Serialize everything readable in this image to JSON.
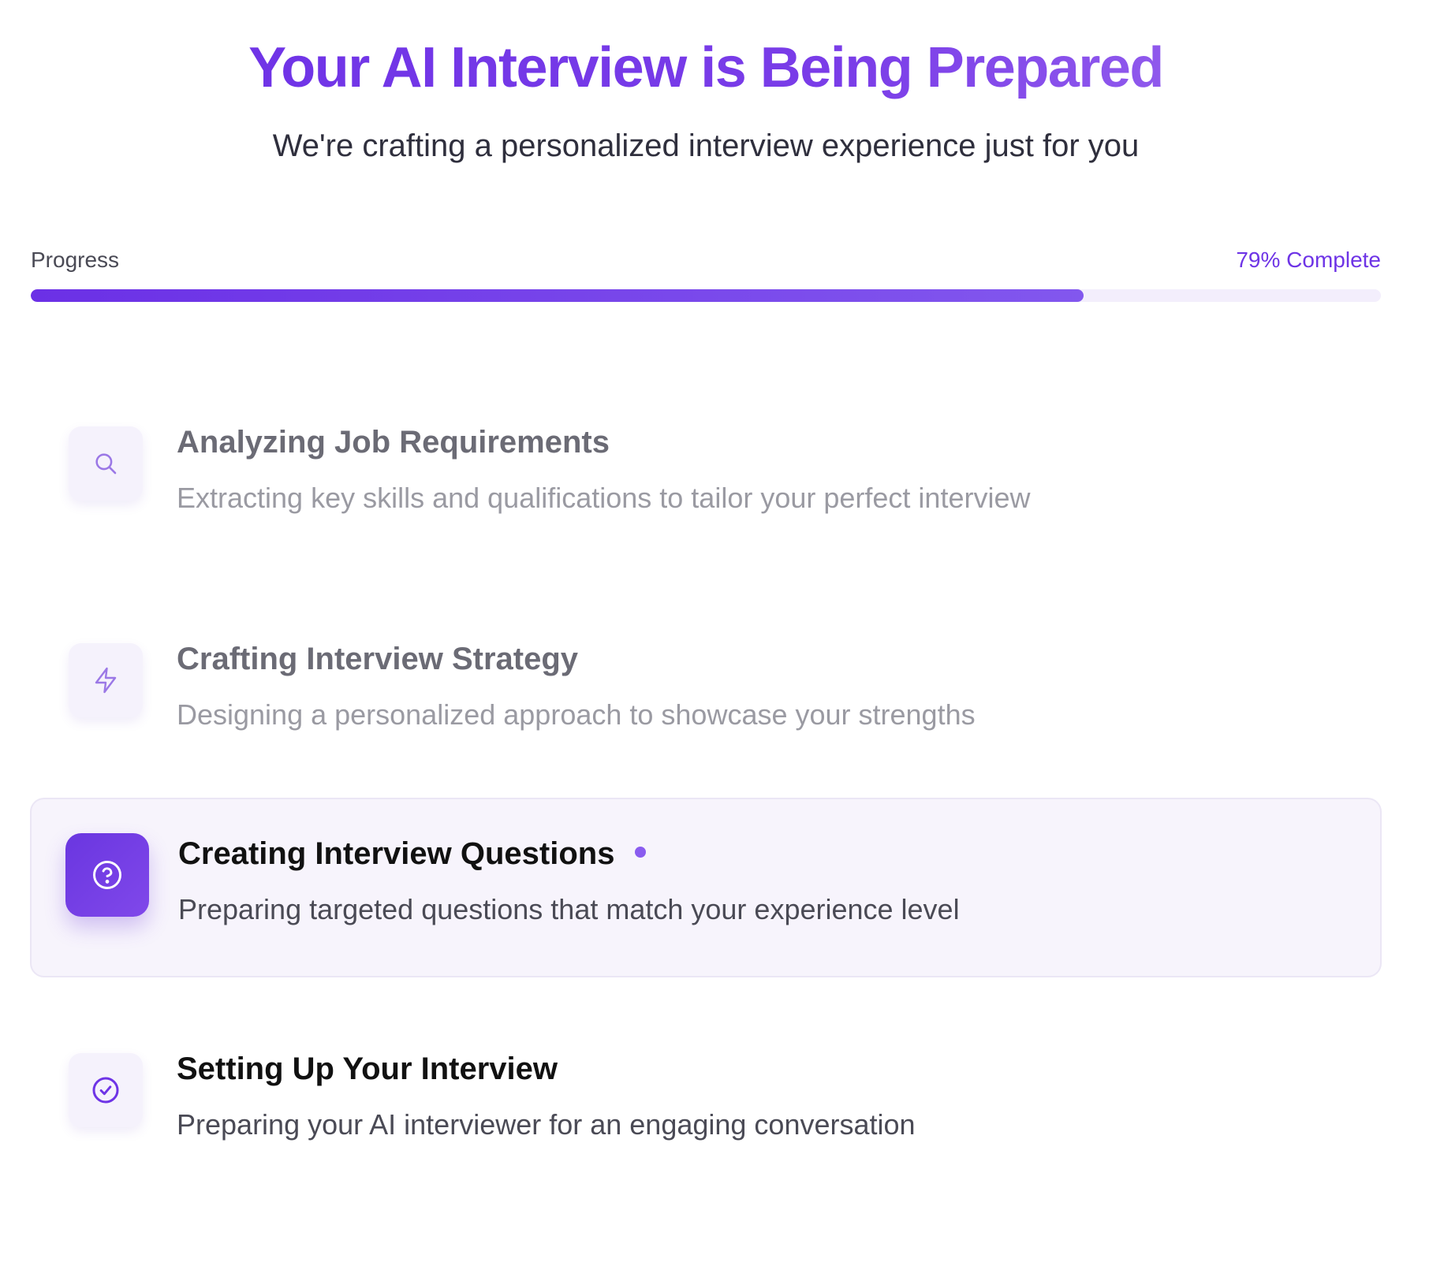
{
  "header": {
    "title": "Your AI Interview is Being Prepared",
    "subtitle": "We're crafting a personalized interview experience just for you"
  },
  "progress": {
    "label": "Progress",
    "percent_text": "79% Complete",
    "value": 0.78
  },
  "steps": [
    {
      "title": "Analyzing Job Requirements",
      "description": "Extracting key skills and qualifications to tailor your perfect interview",
      "icon": "search-icon",
      "state": "done"
    },
    {
      "title": "Crafting Interview Strategy",
      "description": "Designing a personalized approach to showcase your strengths",
      "icon": "lightning-icon",
      "state": "done"
    },
    {
      "title": "Creating Interview Questions",
      "description": "Preparing targeted questions that match your experience level",
      "icon": "question-circle-icon",
      "state": "active"
    },
    {
      "title": "Setting Up Your Interview",
      "description": "Preparing your AI interviewer for an engaging conversation",
      "icon": "check-circle-icon",
      "state": "pending"
    }
  ],
  "colors": {
    "accent": "#6e34e6",
    "accent_light": "#8a5cef",
    "track": "#f3eefc",
    "active_card": "#f7f4fc"
  }
}
